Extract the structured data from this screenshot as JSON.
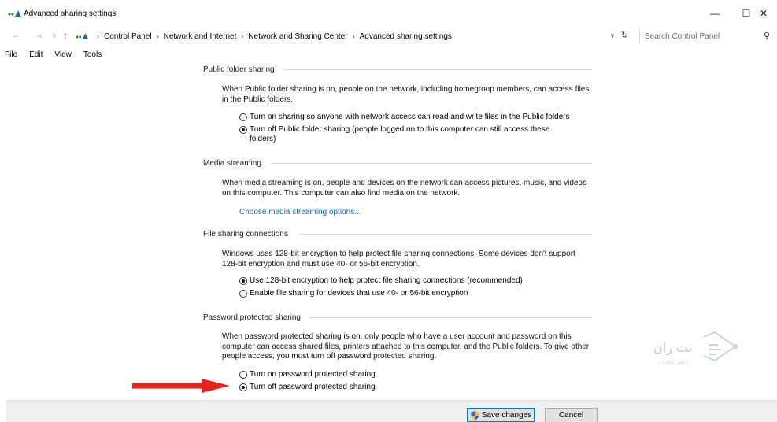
{
  "window": {
    "title": "Advanced sharing settings",
    "minimize_icon": "minimize-icon",
    "maximize_icon": "maximize-icon",
    "close_icon": "close-icon"
  },
  "address": {
    "breadcrumbs": [
      "Control Panel",
      "Network and Internet",
      "Network and Sharing Center",
      "Advanced sharing settings"
    ],
    "search_placeholder": "Search Control Panel"
  },
  "menu": [
    "File",
    "Edit",
    "View",
    "Tools"
  ],
  "sections": {
    "public_folder": {
      "heading": "Public folder sharing",
      "description": "When Public folder sharing is on, people on the network, including homegroup members, can access files in the Public folders.",
      "options": [
        {
          "label": "Turn on sharing so anyone with network access can read and write files in the Public folders",
          "checked": false
        },
        {
          "label": "Turn off Public folder sharing (people logged on to this computer can still access these folders)",
          "checked": true
        }
      ]
    },
    "media": {
      "heading": "Media streaming",
      "description": "When media streaming is on, people and devices on the network can access pictures, music, and videos on this computer. This computer can also find media on the network.",
      "link": "Choose media streaming options..."
    },
    "file_sharing": {
      "heading": "File sharing connections",
      "description": "Windows uses 128-bit encryption to help protect file sharing connections. Some devices don't support 128-bit encryption and must use 40- or 56-bit encryption.",
      "options": [
        {
          "label": "Use 128-bit encryption to help protect file sharing connections (recommended)",
          "checked": true
        },
        {
          "label": "Enable file sharing for devices that use 40- or 56-bit encryption",
          "checked": false
        }
      ]
    },
    "password": {
      "heading": "Password protected sharing",
      "description": "When password protected sharing is on, only people who have a user account and password on this computer can access shared files, printers attached to this computer, and the Public folders. To give other people access, you must turn off password protected sharing.",
      "options": [
        {
          "label": "Turn on password protected sharing",
          "checked": false
        },
        {
          "label": "Turn off password protected sharing",
          "checked": true
        }
      ]
    }
  },
  "buttons": {
    "save": "Save changes",
    "cancel": "Cancel"
  },
  "watermark": {
    "text": "نت ران",
    "sub": "راهی ساده تر"
  },
  "colors": {
    "link": "#0066cc",
    "arrow": "#e8221b",
    "accent": "#0078d7"
  }
}
